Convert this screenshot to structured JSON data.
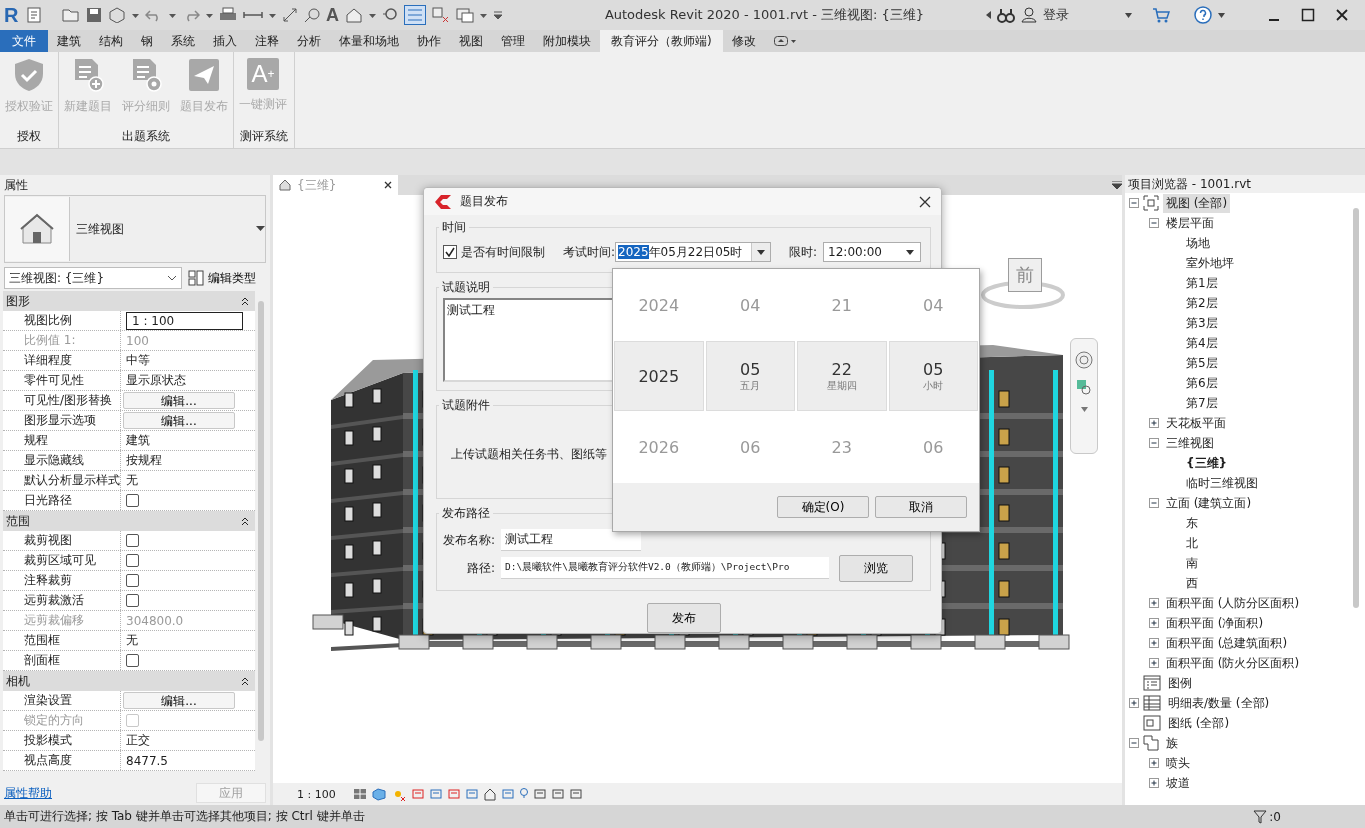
{
  "window": {
    "logo": "R",
    "text_tool": "A",
    "title": "Autodesk Revit 2020 - 1001.rvt - 三维视图: {三维}",
    "login": "登录"
  },
  "ribbon": {
    "tabs": [
      {
        "label": "文件",
        "kind": "file",
        "selected": false
      },
      {
        "label": "建筑",
        "kind": "tab",
        "selected": false
      },
      {
        "label": "结构",
        "kind": "tab",
        "selected": false
      },
      {
        "label": "钢",
        "kind": "tab",
        "selected": false
      },
      {
        "label": "系统",
        "kind": "tab",
        "selected": false
      },
      {
        "label": "插入",
        "kind": "tab",
        "selected": false
      },
      {
        "label": "注释",
        "kind": "tab",
        "selected": false
      },
      {
        "label": "分析",
        "kind": "tab",
        "selected": false
      },
      {
        "label": "体量和场地",
        "kind": "tab",
        "selected": false
      },
      {
        "label": "协作",
        "kind": "tab",
        "selected": false
      },
      {
        "label": "视图",
        "kind": "tab",
        "selected": false
      },
      {
        "label": "管理",
        "kind": "tab",
        "selected": false
      },
      {
        "label": "附加模块",
        "kind": "tab",
        "selected": false
      },
      {
        "label": "教育评分（教师端)",
        "kind": "tab",
        "selected": true
      },
      {
        "label": "修改",
        "kind": "tab",
        "selected": false
      }
    ],
    "groups": [
      {
        "label": "授权",
        "buttons": [
          {
            "label": "授权验证",
            "kind": "shield",
            "disabled": true
          }
        ]
      },
      {
        "label": "出题系统",
        "buttons": [
          {
            "label": "新建题目",
            "kind": "new-doc",
            "disabled": true
          },
          {
            "label": "评分细则",
            "kind": "rules-doc",
            "disabled": true
          },
          {
            "label": "题目发布",
            "kind": "send",
            "disabled": true
          }
        ]
      },
      {
        "label": "测评系统",
        "buttons": [
          {
            "label": "一键测评",
            "kind": "glyph",
            "glyph": "A",
            "glyph_mark": "+",
            "disabled": true
          }
        ]
      }
    ]
  },
  "properties": {
    "title": "属性",
    "type_name": "三维视图",
    "view_selector": "三维视图: {三维}",
    "edit_type": "编辑类型",
    "sections": [
      {
        "title": "图形",
        "rows": [
          {
            "name": "视图比例",
            "kind": "input",
            "value": "1 : 100",
            "disabled": false
          },
          {
            "name": "比例值 1:",
            "kind": "text",
            "value": "100",
            "disabled": true
          },
          {
            "name": "详细程度",
            "kind": "text",
            "value": "中等",
            "disabled": false
          },
          {
            "name": "零件可见性",
            "kind": "text",
            "value": "显示原状态",
            "disabled": false
          },
          {
            "name": "可见性/图形替换",
            "kind": "button",
            "value": "编辑...",
            "disabled": false
          },
          {
            "name": "图形显示选项",
            "kind": "button",
            "value": "编辑...",
            "disabled": false
          },
          {
            "name": "规程",
            "kind": "text",
            "value": "建筑",
            "disabled": false
          },
          {
            "name": "显示隐藏线",
            "kind": "text",
            "value": "按规程",
            "disabled": false
          },
          {
            "name": "默认分析显示样式",
            "kind": "text",
            "value": "无",
            "disabled": false
          },
          {
            "name": "日光路径",
            "kind": "checkbox",
            "checked": false,
            "disabled": false
          }
        ]
      },
      {
        "title": "范围",
        "rows": [
          {
            "name": "裁剪视图",
            "kind": "checkbox",
            "checked": false,
            "disabled": false
          },
          {
            "name": "裁剪区域可见",
            "kind": "checkbox",
            "checked": false,
            "disabled": false
          },
          {
            "name": "注释裁剪",
            "kind": "checkbox",
            "checked": false,
            "disabled": false
          },
          {
            "name": "远剪裁激活",
            "kind": "checkbox",
            "checked": false,
            "disabled": false
          },
          {
            "name": "远剪裁偏移",
            "kind": "text",
            "value": "304800.0",
            "disabled": true
          },
          {
            "name": "范围框",
            "kind": "text",
            "value": "无",
            "disabled": false
          },
          {
            "name": "剖面框",
            "kind": "checkbox",
            "checked": false,
            "disabled": false
          }
        ]
      },
      {
        "title": "相机",
        "rows": [
          {
            "name": "渲染设置",
            "kind": "button",
            "value": "编辑...",
            "disabled": false
          },
          {
            "name": "锁定的方向",
            "kind": "checkbox",
            "checked": false,
            "disabled": true
          },
          {
            "name": "投影模式",
            "kind": "text",
            "value": "正交",
            "disabled": false
          },
          {
            "name": "视点高度",
            "kind": "text",
            "value": "8477.5",
            "disabled": false
          }
        ]
      }
    ],
    "help_link": "属性帮助",
    "apply": {
      "label": "应用",
      "disabled": true
    }
  },
  "view_tab": {
    "title": "{三维}"
  },
  "viewcube": {
    "face": "前"
  },
  "view_status": {
    "scale": "1 : 100"
  },
  "dialog": {
    "title": "题目发布",
    "time_group": "时间",
    "time_limit": {
      "label": "是否有时间限制",
      "checked": true
    },
    "exam_time": {
      "label": "考试时间:",
      "selected_part": "2025",
      "rest": "年05月22日05时"
    },
    "limit": {
      "label": "限时:",
      "value": "12:00:00"
    },
    "description_group": "试题说明",
    "description": "测试工程",
    "attachment_group": "试题附件",
    "attachment_text": "上传试题相关任务书、图纸等",
    "publish_group": "发布路径",
    "name_label": "发布名称:",
    "name_value": "测试工程",
    "path_label": "路径:",
    "path_value": "D:\\晨曦软件\\晨曦教育评分软件V2.0（教师端）\\Project\\Pro",
    "browse": "浏览",
    "publish": "发布",
    "picker": {
      "columns": [
        {
          "prev": "2024",
          "current": "2025",
          "next": "2026"
        },
        {
          "prev": "04",
          "current": "05",
          "caption": "五月",
          "next": "06"
        },
        {
          "prev": "21",
          "current": "22",
          "caption": "星期四",
          "next": "23"
        },
        {
          "prev": "04",
          "current": "05",
          "caption": "小时",
          "next": "06"
        }
      ],
      "ok": "确定(O)",
      "cancel": "取消"
    }
  },
  "project_browser": {
    "title": "项目浏览器 - 1001.rvt",
    "tree": [
      {
        "label": "视图 (全部)",
        "kind": "views",
        "selected": true,
        "expanded": true,
        "children": [
          {
            "label": "楼层平面",
            "selected": false,
            "expanded": true,
            "children": [
              {
                "label": "场地",
                "selected": false
              },
              {
                "label": "室外地坪",
                "selected": false
              },
              {
                "label": "第1层",
                "selected": false
              },
              {
                "label": "第2层",
                "selected": false
              },
              {
                "label": "第3层",
                "selected": false
              },
              {
                "label": "第4层",
                "selected": false
              },
              {
                "label": "第5层",
                "selected": false
              },
              {
                "label": "第6层",
                "selected": false
              },
              {
                "label": "第7层",
                "selected": false
              }
            ]
          },
          {
            "label": "天花板平面",
            "selected": false,
            "expanded": false
          },
          {
            "label": "三维视图",
            "selected": false,
            "expanded": true,
            "children": [
              {
                "label": "{三维}",
                "selected": false,
                "active": true
              },
              {
                "label": "临时三维视图",
                "selected": false,
                "active": false
              }
            ]
          },
          {
            "label": "立面 (建筑立面)",
            "selected": false,
            "expanded": true,
            "children": [
              {
                "label": "东",
                "selected": false
              },
              {
                "label": "北",
                "selected": false
              },
              {
                "label": "南",
                "selected": false
              },
              {
                "label": "西",
                "selected": false
              }
            ]
          },
          {
            "label": "面积平面 (人防分区面积)",
            "selected": false,
            "expanded": false
          },
          {
            "label": "面积平面 (净面积)",
            "selected": false,
            "expanded": false
          },
          {
            "label": "面积平面 (总建筑面积)",
            "selected": false,
            "expanded": false
          },
          {
            "label": "面积平面 (防火分区面积)",
            "selected": false,
            "expanded": false
          }
        ]
      },
      {
        "label": "图例",
        "kind": "legend",
        "selected": false
      },
      {
        "label": "明细表/数量 (全部)",
        "kind": "schedule",
        "selected": false,
        "expanded": false
      },
      {
        "label": "图纸 (全部)",
        "kind": "sheet",
        "selected": false
      },
      {
        "label": "族",
        "kind": "family",
        "selected": false,
        "expanded": true,
        "children": [
          {
            "label": "喷头",
            "selected": false,
            "expanded": false
          },
          {
            "label": "坡道",
            "selected": false,
            "expanded": false
          }
        ]
      }
    ]
  },
  "status_bar": {
    "text": "单击可进行选择; 按 Tab 键并单击可选择其他项目; 按 Ctrl 键并单击",
    "filter": ":0"
  }
}
